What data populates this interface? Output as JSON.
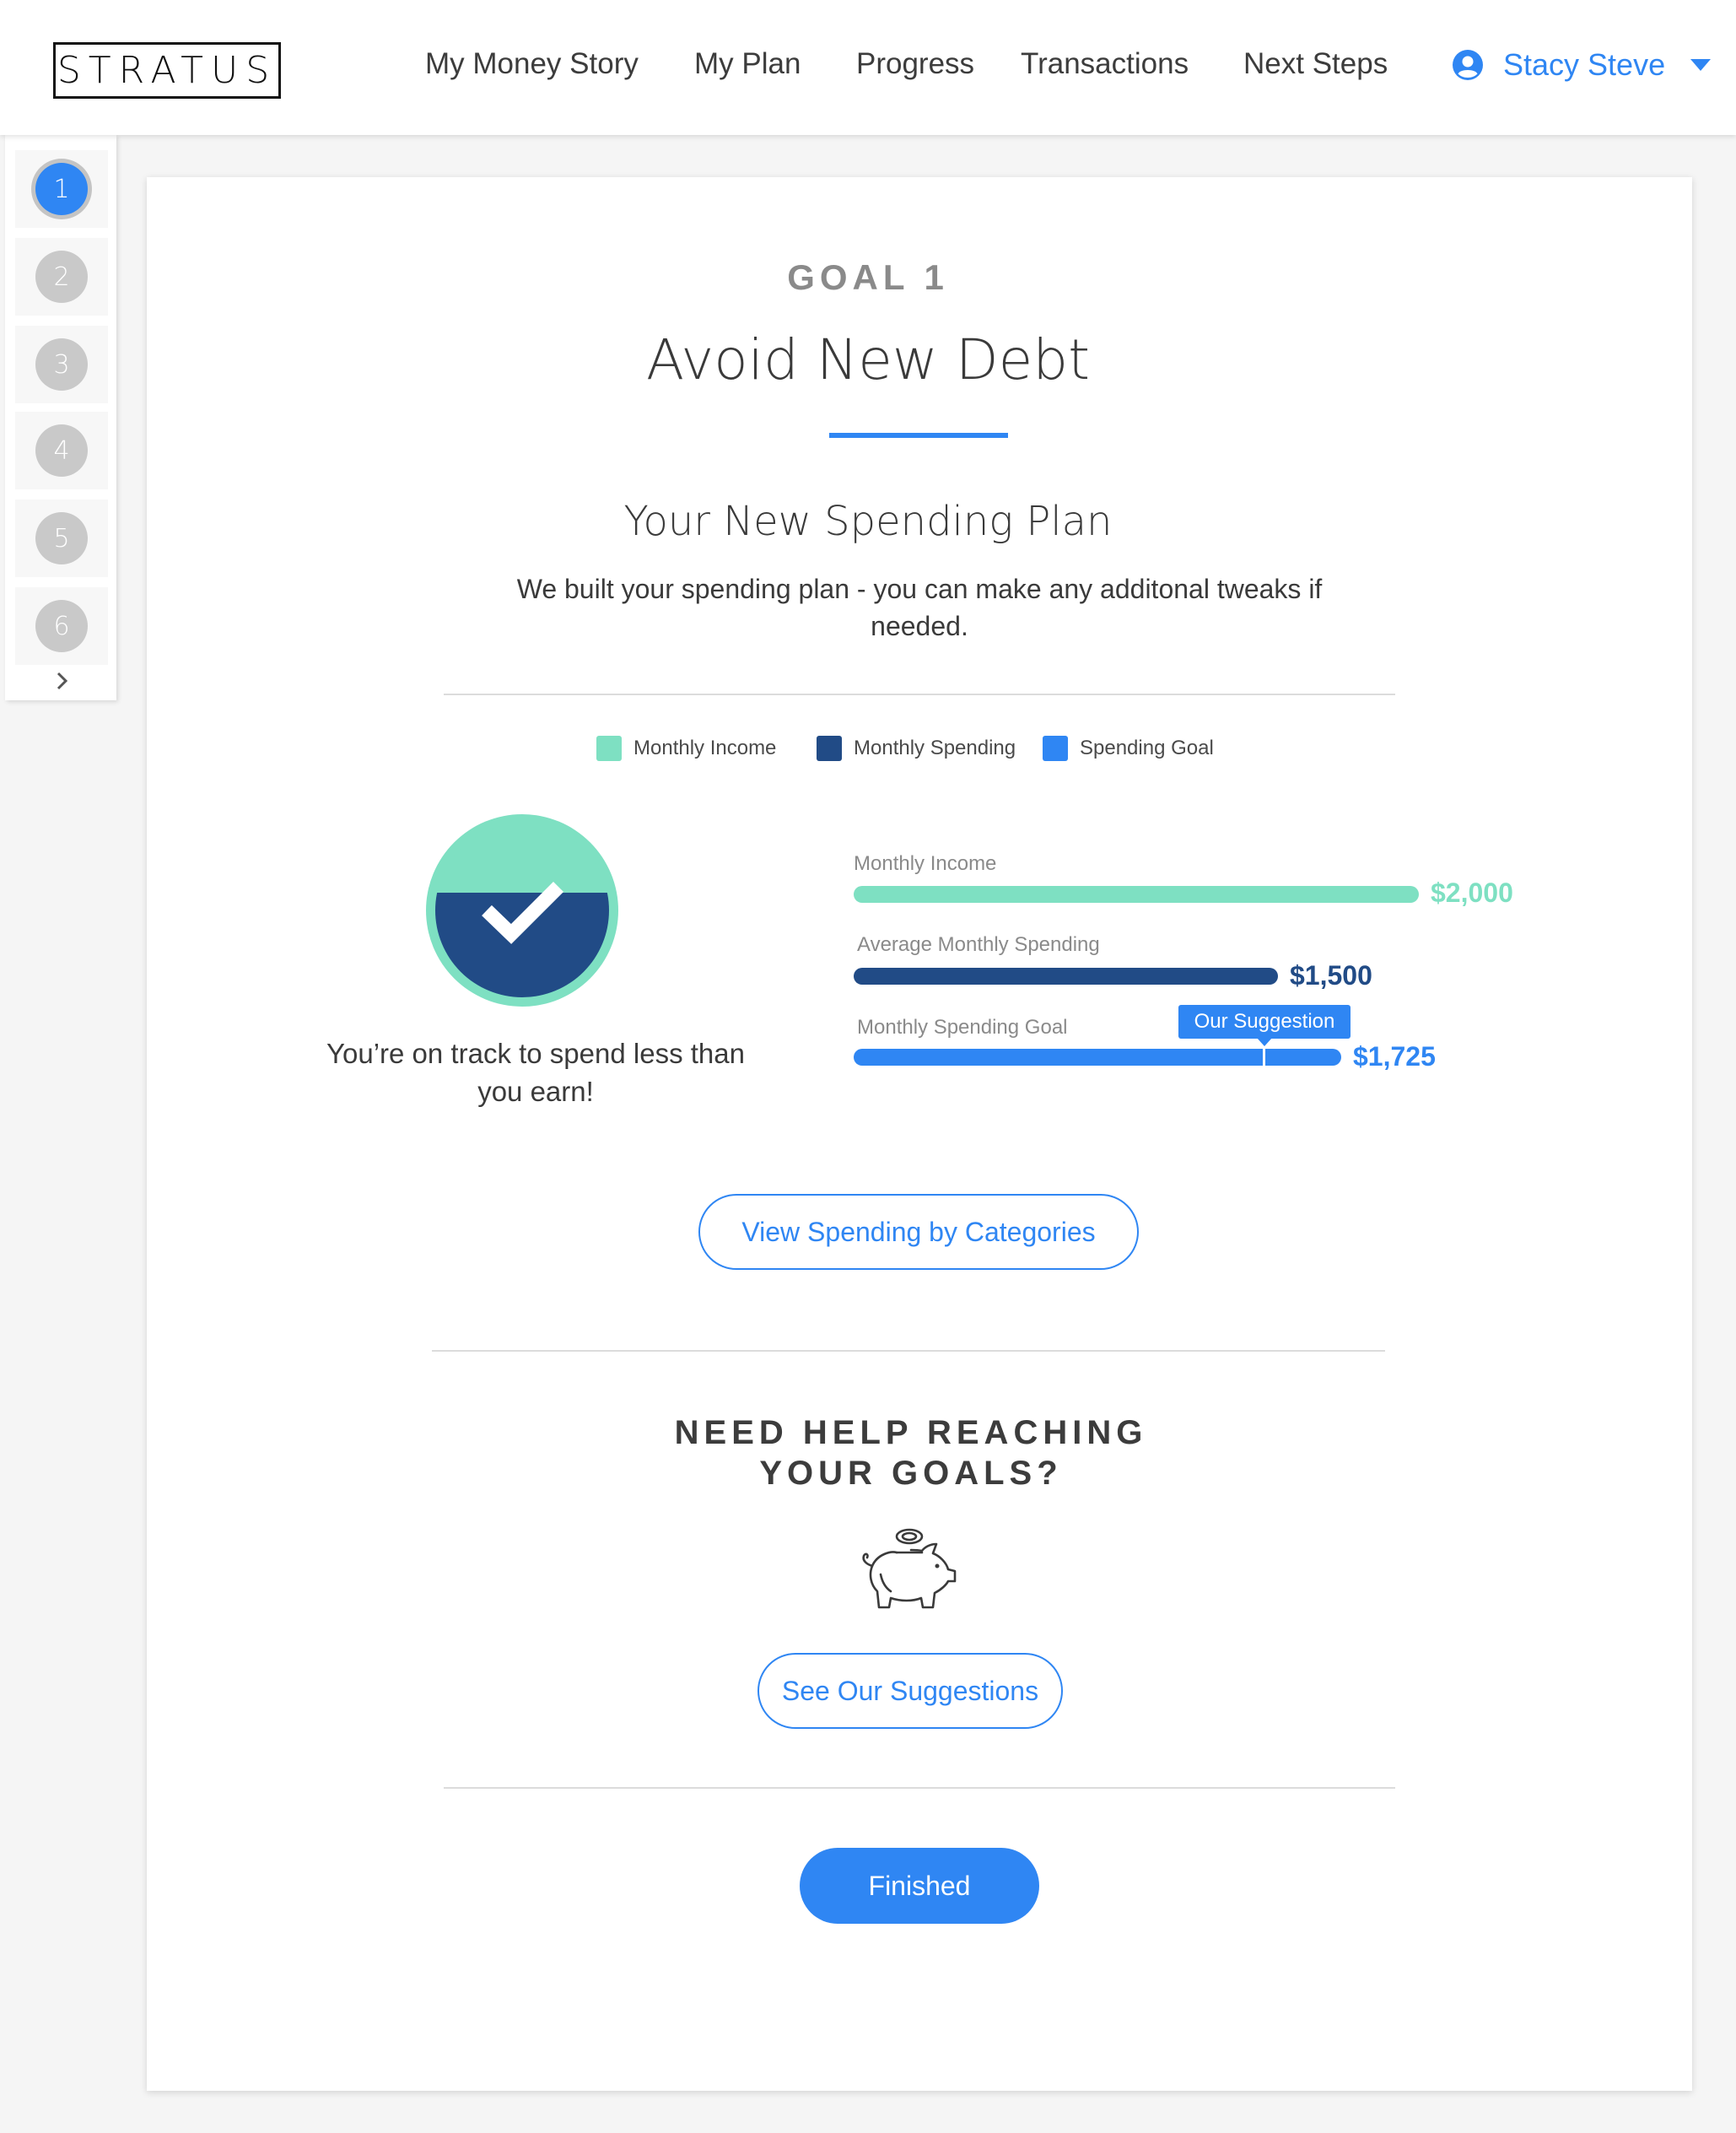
{
  "header": {
    "logo": "STRATUS",
    "nav": [
      "My Money Story",
      "My Plan",
      "Progress",
      "Transactions",
      "Next Steps"
    ],
    "user_name": "Stacy Steve",
    "icons": {
      "user": "user-circle-icon",
      "caret": "caret-down-icon"
    }
  },
  "steps": {
    "items": [
      "1",
      "2",
      "3",
      "4",
      "5",
      "6"
    ],
    "active_index": 0,
    "next_icon": "chevron-right-icon"
  },
  "goal": {
    "label": "GOAL 1",
    "title": "Avoid New Debt"
  },
  "plan": {
    "title": "Your New Spending Plan",
    "subtitle": "We built your spending plan - you can make any additonal tweaks if needed."
  },
  "legend": [
    {
      "label": "Monthly Income",
      "color": "#7ee0c2"
    },
    {
      "label": "Monthly Spending",
      "color": "#214b86"
    },
    {
      "label": "Spending Goal",
      "color": "#2f86f3"
    }
  ],
  "status": {
    "icon": "checkmark-badge-icon",
    "text": "You’re on track to spend less than you earn!"
  },
  "bars": [
    {
      "label": "Monthly Income",
      "value": "$2,000",
      "amount": 2000,
      "color": "#7ee0c2"
    },
    {
      "label": "Average Monthly Spending",
      "value": "$1,500",
      "amount": 1500,
      "color": "#214b86"
    },
    {
      "label": "Monthly Spending Goal",
      "value": "$1,725",
      "amount": 1725,
      "color": "#2f86f3"
    }
  ],
  "suggestion": {
    "label": "Our Suggestion"
  },
  "buttons": {
    "view_categories": "View Spending by Categories",
    "see_suggestions": "See Our Suggestions",
    "finished": "Finished"
  },
  "help": {
    "line1": "NEED HELP REACHING",
    "line2": "YOUR GOALS?",
    "icon": "piggy-bank-icon"
  }
}
